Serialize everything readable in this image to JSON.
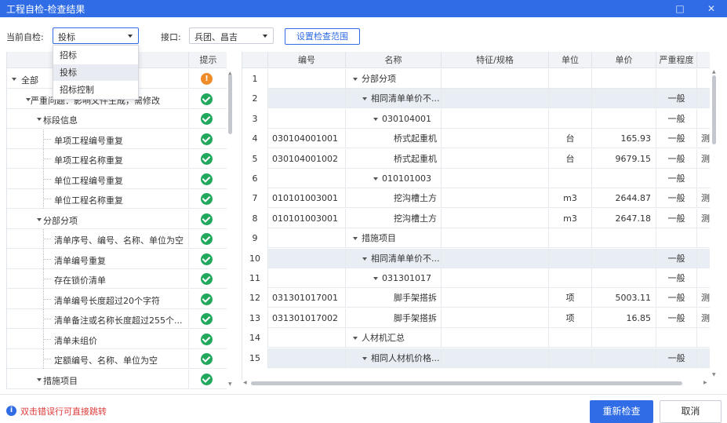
{
  "window": {
    "title": "工程自检-检查结果",
    "minimize_icon": "window-restore-icon",
    "close_icon": "close-icon"
  },
  "toolbar": {
    "current_check_label": "当前自检:",
    "current_check_value": "投标",
    "interface_label": "接口:",
    "interface_value": "兵团、昌吉",
    "set_range_button": "设置检查范围"
  },
  "dropdown": {
    "options": [
      "招标",
      "投标",
      "招标控制"
    ],
    "selected_index": 1
  },
  "left_tree": {
    "hint_header": "提示",
    "rows": [
      {
        "label": "全部",
        "status": "warning"
      },
      {
        "label": "严重问题：影响文件生成，需修改",
        "status": "ok"
      },
      {
        "label": "标段信息",
        "status": "ok"
      },
      {
        "label": "单项工程编号重复",
        "status": "ok"
      },
      {
        "label": "单项工程名称重复",
        "status": "ok"
      },
      {
        "label": "单位工程编号重复",
        "status": "ok"
      },
      {
        "label": "单位工程名称重复",
        "status": "ok"
      },
      {
        "label": "分部分项",
        "status": "ok"
      },
      {
        "label": "清单序号、编号、名称、单位为空",
        "status": "ok"
      },
      {
        "label": "清单编号重复",
        "status": "ok"
      },
      {
        "label": "存在锁价清单",
        "status": "ok"
      },
      {
        "label": "清单编号长度超过20个字符",
        "status": "ok"
      },
      {
        "label": "清单备注或名称长度超过255个...",
        "status": "ok"
      },
      {
        "label": "清单未组价",
        "status": "ok"
      },
      {
        "label": "定额编号、名称、单位为空",
        "status": "ok"
      },
      {
        "label": "措施项目",
        "status": "ok"
      }
    ]
  },
  "right_grid": {
    "headers": [
      "编号",
      "名称",
      "特征/规格",
      "单位",
      "单价",
      "严重程度"
    ],
    "rows": [
      {
        "no": "1",
        "code": "",
        "name": "分部分项",
        "spec": "",
        "unit": "",
        "price": "",
        "severity": "",
        "extra": ""
      },
      {
        "no": "2",
        "code": "",
        "name": "相同清单单价不...",
        "spec": "",
        "unit": "",
        "price": "",
        "severity": "一般",
        "extra": ""
      },
      {
        "no": "3",
        "code": "",
        "name": "030104001",
        "spec": "",
        "unit": "",
        "price": "",
        "severity": "一般",
        "extra": ""
      },
      {
        "no": "4",
        "code": "030104001001",
        "name": "桥式起重机",
        "spec": "",
        "unit": "台",
        "price": "165.93",
        "severity": "一般",
        "extra": "测"
      },
      {
        "no": "5",
        "code": "030104001002",
        "name": "桥式起重机",
        "spec": "",
        "unit": "台",
        "price": "9679.15",
        "severity": "一般",
        "extra": "测"
      },
      {
        "no": "6",
        "code": "",
        "name": "010101003",
        "spec": "",
        "unit": "",
        "price": "",
        "severity": "一般",
        "extra": ""
      },
      {
        "no": "7",
        "code": "010101003001",
        "name": "挖沟槽土方",
        "spec": "",
        "unit": "m3",
        "price": "2644.87",
        "severity": "一般",
        "extra": "测"
      },
      {
        "no": "8",
        "code": "010101003001",
        "name": "挖沟槽土方",
        "spec": "",
        "unit": "m3",
        "price": "2647.18",
        "severity": "一般",
        "extra": "测"
      },
      {
        "no": "9",
        "code": "",
        "name": "措施项目",
        "spec": "",
        "unit": "",
        "price": "",
        "severity": "",
        "extra": ""
      },
      {
        "no": "10",
        "code": "",
        "name": "相同清单单价不...",
        "spec": "",
        "unit": "",
        "price": "",
        "severity": "一般",
        "extra": ""
      },
      {
        "no": "11",
        "code": "",
        "name": "031301017",
        "spec": "",
        "unit": "",
        "price": "",
        "severity": "一般",
        "extra": ""
      },
      {
        "no": "12",
        "code": "031301017001",
        "name": "脚手架搭拆",
        "spec": "",
        "unit": "项",
        "price": "5003.11",
        "severity": "一般",
        "extra": "测"
      },
      {
        "no": "13",
        "code": "031301017002",
        "name": "脚手架搭拆",
        "spec": "",
        "unit": "项",
        "price": "16.85",
        "severity": "一般",
        "extra": "测"
      },
      {
        "no": "14",
        "code": "",
        "name": "人材机汇总",
        "spec": "",
        "unit": "",
        "price": "",
        "severity": "",
        "extra": ""
      },
      {
        "no": "15",
        "code": "",
        "name": "相同人材机价格...",
        "spec": "",
        "unit": "",
        "price": "",
        "severity": "一般",
        "extra": ""
      }
    ]
  },
  "footer": {
    "hint": "双击错误行可直接跳转",
    "recheck_button": "重新检查",
    "cancel_button": "取消"
  },
  "colors": {
    "accent": "#2f6ce5",
    "ok": "#22a85d",
    "warning": "#f08c28",
    "hint_red": "#e03b3b",
    "highlight_row": "#e9eef5"
  }
}
